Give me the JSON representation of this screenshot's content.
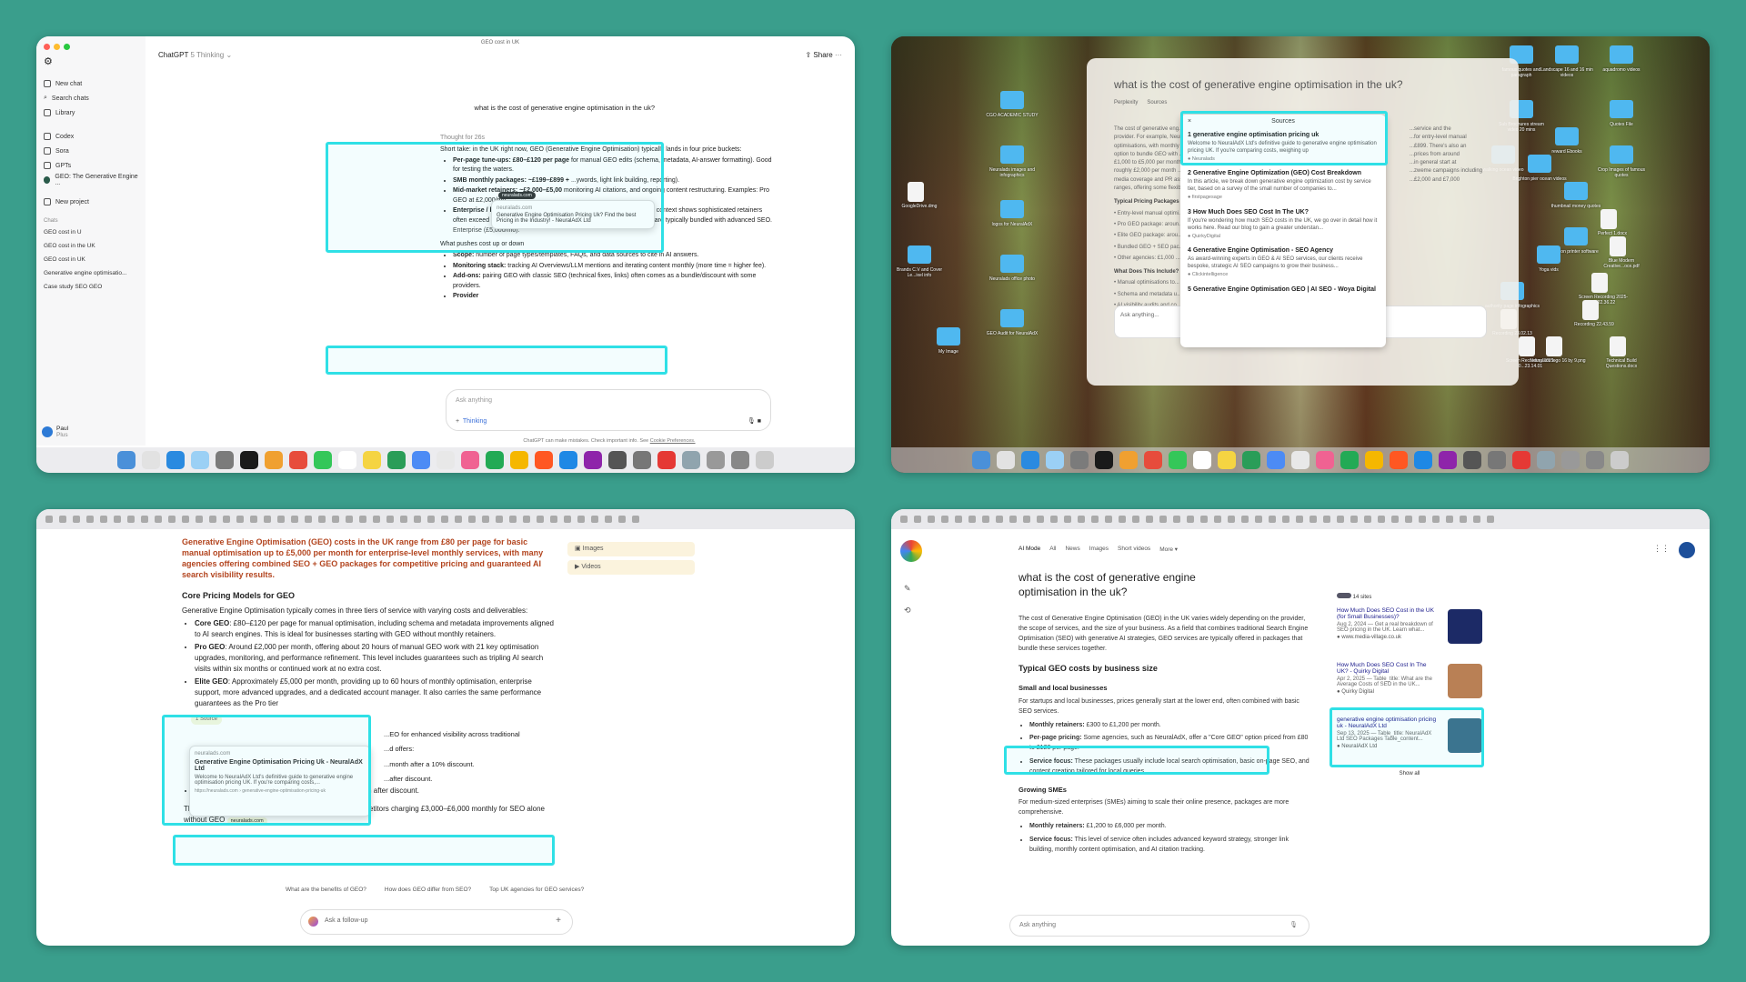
{
  "p1": {
    "window_title": "GEO cost in UK",
    "model": "ChatGPT",
    "model_mode": "5 Thinking",
    "share": "Share",
    "sidebar": {
      "new_chat": "New chat",
      "search_chats": "Search chats",
      "library": "Library",
      "codex": "Codex",
      "sora": "Sora",
      "gpts": "GPTs",
      "gpt_item": "GEO: The Generative Engine ...",
      "new_project": "New project",
      "chats_label": "Chats",
      "chats": [
        "GEO cost in U",
        "GEO cost in the UK",
        "GEO cost in UK",
        "Generative engine optimisatio...",
        "Case study SEO GEO"
      ],
      "user": "Paul",
      "plan": "Plus"
    },
    "question": "what is the cost of generative engine optimisation in the uk?",
    "thought": "Thought for 26s",
    "intro": "Short take: in the UK right now, GEO (Generative Engine Optimisation) typically lands in four price buckets:",
    "bullets": [
      {
        "b": "Per-page tune-ups: £80–£120 per page",
        "t": " for manual GEO edits (schema, metadata, AI-answer formatting). Good for testing the waters."
      },
      {
        "b": "SMB monthly packages: ~£199–£899 +",
        "t": " ...ywords, light link building, reporting)."
      },
      {
        "b": "Mid-market retainers: ~£2,000–£5,00",
        "t": " monitoring AI citations, and ongoing content restructuring. Examples: Pro GEO at £2,000/mo;"
      },
      {
        "b": "Enterprise / bespoke:",
        "t": " widely variable and usually quoted, but UK SEO context shows sophisticated retainers often exceed £5k/mo where scope is large; GEO programs at that level are typically bundled with advanced SEO."
      }
    ],
    "enterprise_line": "Enterprise (£5,000/mo).",
    "pushes_title": "What pushes cost up or down",
    "pushes": [
      {
        "b": "Scope:",
        "t": " number of page types/templates, FAQs, and data sources to cite in AI answers."
      },
      {
        "b": "Monitoring stack:",
        "t": " tracking AI Overviews/LLM mentions and iterating content monthly (more time = higher fee)."
      },
      {
        "b": "Add-ons:",
        "t": " pairing GEO with classic SEO (technical fixes, links) often comes as a bundle/discount with some providers."
      },
      {
        "b": "Provider",
        "t": ""
      }
    ],
    "popup": {
      "domain": "neuralads.com",
      "text": "Generative Engine Optimisation Pricing Uk? Find the best Pricing in the Industry! - NeuralAdX Ltd"
    },
    "cite": "neuralads.com",
    "compose_placeholder": "Ask anything",
    "thinking": "Thinking",
    "disclaimer": "ChatGPT can make mistakes. Check important info. See",
    "cookie": "Cookie Preferences."
  },
  "p2": {
    "title": "what is the cost of generative engine optimisation in the uk?",
    "tab_perplexity": "Perplexity",
    "tab_sources": "Sources",
    "body_lines": [
      "The cost of generative eng...",
      "provider. For example, Neura...",
      "optimisations, with monthly ...",
      "option to bundle GEO with ...",
      "£1,000 to £5,000 per month ...",
      "roughly £2,000 per month ...",
      "media coverage and PR asse...",
      "ranges, offering some flexibility ..."
    ],
    "right_lines": [
      "...service and the",
      "...for entry-level manual",
      "...£899. There's also an",
      "...prices from around",
      "...in general start at",
      "...zweme campaigns including",
      "...£2,000 and £7,000"
    ],
    "typical": "Typical Pricing Packages fo...",
    "packages": [
      "Entry-level manual optimi...",
      "Pro GEO package: aroun...",
      "Elite GEO package: arou...",
      "Bundled GEO + SEO pac...",
      "Other agencies: £1,000 ..."
    ],
    "include_title": "What Does This Include?",
    "include": [
      "Manual optimisations to...",
      "Schema and metadata u...",
      "AI visibility audits and co..."
    ],
    "ask": "Ask anything...",
    "sources_title": "Sources",
    "sources": [
      {
        "n": "1",
        "title": "generative engine optimisation pricing uk",
        "desc": "Welcome to NeuralAdX Ltd's definitive guide to generative engine optimisation pricing UK. If you're comparing costs, weighing up",
        "site": "Neuralads"
      },
      {
        "n": "2",
        "title": "Generative Engine Optimization (GEO) Cost Breakdown",
        "desc": "In this article, we break down generative engine optimization cost by service tier, based on a survey of the small number of companies to...",
        "site": "firstpagesage"
      },
      {
        "n": "3",
        "title": "How Much Does SEO Cost In The UK?",
        "desc": "If you're wondering how much SEO costs in the UK, we go over in detail how it works here. Read our blog to gain a greater understan...",
        "site": "QuirkyDigital"
      },
      {
        "n": "4",
        "title": "Generative Engine Optimisation - SEO Agency",
        "desc": "As award-winning experts in GEO & AI SEO services, our clients receive bespoke, strategic AI SEO campaigns to grow their business...",
        "site": "Clickintelligence"
      },
      {
        "n": "5",
        "title": "Generative Engine Optimisation GEO | AI SEO - Woya Digital",
        "desc": "",
        "site": ""
      }
    ],
    "desktop_labels": [
      "CGO ACADEMIC STUDY",
      "Neuralads images and infographics",
      "logos for NeuralAdX",
      "Neuralads office photo",
      "GEO Audit for NeuralAdX",
      "My Image",
      "GoogleDrive.dmg",
      "Brands C.V and Cover Le...ixel info",
      "famous quotes and paragraph",
      "Landscape 16 and 16 min videos",
      "aquadromo videos",
      "Quotes File",
      "Sub Brochures stream video 20 mins",
      "reward Ebooks",
      "Brighton pier ocean videos",
      "walking ocean video",
      "Crop Images of famous quotes",
      "thumbnail money quotes",
      "Perfect 1.docx",
      "canon printer software",
      "Blue Modern Creative...oce.pdf",
      "Yoga vids",
      "Screen Recording 2025-0...22.36.22",
      "authority page infographics",
      "Recording 22.43.59",
      "Recording 23.02.13",
      "Screen Recording 2025-0...23.14.01",
      "Neuralads logo 16 by 9.png",
      "Technical Build Questions.docx"
    ]
  },
  "p3": {
    "lead": "Generative Engine Optimisation (GEO) costs in the UK range from £80 per page for basic manual optimisation up to £5,000 per month for enterprise-level monthly services, with many agencies offering combined SEO + GEO packages for competitive pricing and guaranteed AI search visibility results.",
    "h_core": "Core Pricing Models for GEO",
    "core_intro": "Generative Engine Optimisation typically comes in three tiers of service with varying costs and deliverables:",
    "tiers": [
      {
        "b": "Core GEO",
        "t": ": £80–£120 per page for manual optimisation, including schema and metadata improvements aligned to AI search engines. This is ideal for businesses starting with GEO without monthly retainers."
      },
      {
        "b": "Pro GEO",
        "t": ": Around £2,000 per month, offering about 20 hours of manual GEO work with 21 key optimisation upgrades, monitoring, and performance refinement. This level includes guarantees such as tripling AI search visits within six months or continued work at no extra cost."
      },
      {
        "b": "Elite GEO",
        "t": ": Approximately £5,000 per month, providing up to 60 hours of monthly optimisation, enterprise support, more advanced upgrades, and a dedicated account manager. It also carries the same performance guarantees as the Pro tier"
      }
    ],
    "source_count": "1 Source",
    "popup_domain": "neuralads.com",
    "popup_title": "Generative Engine Optimisation Pricing Uk - NeuralAdX Ltd",
    "popup_desc": "Welcome to NeuralAdX Ltd's definitive guide to generative engine optimisation pricing UK. If you're comparing costs,...",
    "popup_url": "https://neuralads.com › generative-engine-optimisation-pricing-uk",
    "partial_lines": [
      "...EO for enhanced visibility across traditional",
      "...d offers:",
      "...month after a 10% discount.",
      "...after discount."
    ],
    "bundle_line": "Elite GEO + Pro SEO (£1,000) bundle at £5,400/month after discount.",
    "value_line": "This bundling offers better value compared to many competitors charging £3,000–£6,000 monthly for SEO alone without GEO",
    "value_cite": "neuralads.com",
    "images": "Images",
    "videos": "Videos",
    "chips": [
      "What are the benefits of GEO?",
      "How does GEO differ from SEO?",
      "Top UK agencies for GEO services?"
    ],
    "followup": "Ask a follow-up"
  },
  "p4": {
    "nav": [
      "AI Mode",
      "All",
      "News",
      "Images",
      "Short videos",
      "More ▾"
    ],
    "query": "what is the cost of generative engine optimisation in the uk?",
    "intro": "The cost of Generative Engine Optimisation (GEO) in the UK varies widely depending on the provider, the scope of services, and the size of your business. As a field that combines traditional Search Engine Optimisation (SEO) with generative AI strategies, GEO services are typically offered in packages that bundle these services together.",
    "h_typical": "Typical GEO costs by business size",
    "h_small": "Small and local businesses",
    "small_intro": "For startups and local businesses, prices generally start at the lower end, often combined with basic SEO services.",
    "small_bullets": [
      {
        "b": "Monthly retainers:",
        "t": " £300 to £1,200 per month."
      },
      {
        "b": "Per-page pricing:",
        "t": " Some agencies, such as NeuralAdX, offer a \"Core GEO\" option priced from £80 to £120 per page."
      },
      {
        "b": "Service focus:",
        "t": " These packages usually include local search optimisation, basic on-page SEO, and content creation tailored for local queries."
      }
    ],
    "h_growing": "Growing SMEs",
    "growing_intro": "For medium-sized enterprises (SMEs) aiming to scale their online presence, packages are more comprehensive.",
    "growing_bullets": [
      {
        "b": "Monthly retainers:",
        "t": " £1,200 to £6,000 per month."
      },
      {
        "b": "Service focus:",
        "t": " This level of service often includes advanced keyword strategy, stronger link building, monthly content optimisation, and AI citation tracking."
      }
    ],
    "sites": "14 sites",
    "cards": [
      {
        "title": "How Much Does SEO Cost in the UK (for Small Businesses)?",
        "meta": "Aug 2, 2024 — Get a real breakdown of SEO pricing in the UK. Learn what...",
        "site": "www.media-village.co.uk",
        "thumb": "#1c2a66"
      },
      {
        "title": "How Much Does SEO Cost In The UK? - Quirky Digital",
        "meta": "Apr 2, 2025 — Table_title: What are the Average Costs of SEO in the UK...",
        "site": "Quirky Digital",
        "thumb": "#b98055"
      },
      {
        "title": "generative engine optimisation pricing uk - NeuralAdX Ltd",
        "meta": "Sep 13, 2025 — Table_title: NeuralAdX Ltd SEO Packages Table_content...",
        "site": "NeuralAdX Ltd",
        "thumb": "#3c6e8a"
      }
    ],
    "show_all": "Show all",
    "ask": "Ask anything"
  }
}
